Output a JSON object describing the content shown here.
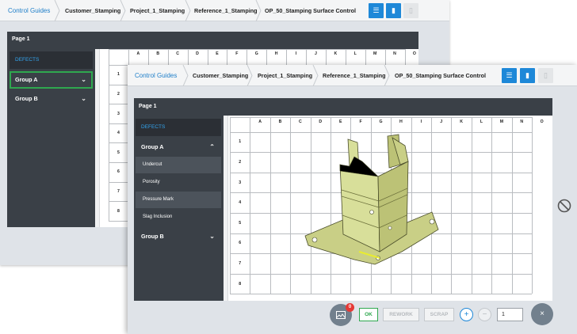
{
  "back_window": {
    "breadcrumbs": [
      "Control Guides",
      "Customer_Stamping",
      "Project_1_Stamping",
      "Reference_1_Stamping",
      "OP_50_Stamping Surface Control"
    ],
    "page_title": "Page 1",
    "sidebar": {
      "defects_label": "DEFECTS",
      "groups": [
        {
          "label": "Group A",
          "expanded": false
        },
        {
          "label": "Group B",
          "expanded": false
        }
      ]
    },
    "grid": {
      "columns": [
        "A",
        "B",
        "C",
        "D",
        "E",
        "F",
        "G",
        "H",
        "I",
        "J",
        "K",
        "L",
        "M",
        "N",
        "O"
      ],
      "rows": [
        "1",
        "2",
        "3",
        "4",
        "5",
        "6",
        "7",
        "8"
      ]
    }
  },
  "front_window": {
    "breadcrumbs": [
      "Control Guides",
      "Customer_Stamping",
      "Project_1_Stamping",
      "Reference_1_Stamping",
      "OP_50_Stamping Surface Control"
    ],
    "page_title": "Page 1",
    "sidebar": {
      "defects_label": "DEFECTS",
      "group_a": {
        "label": "Group A",
        "expanded": true,
        "items": [
          "Undercut",
          "Porosity",
          "Pressure Mark",
          "Slag Inclusion"
        ]
      },
      "group_b": {
        "label": "Group B",
        "expanded": false
      }
    },
    "grid": {
      "columns": [
        "A",
        "B",
        "C",
        "D",
        "E",
        "F",
        "G",
        "H",
        "I",
        "J",
        "K",
        "L",
        "M",
        "N",
        "O"
      ],
      "rows": [
        "1",
        "2",
        "3",
        "4",
        "5",
        "6",
        "7",
        "8"
      ]
    },
    "actions": {
      "photo_badge_count": "0",
      "ok_label": "OK",
      "rework_label": "REWORK",
      "scrap_label": "SCRAP",
      "plus_label": "+",
      "minus_label": "−",
      "quantity": "1",
      "close_label": "×"
    }
  },
  "icons": {
    "toolbar": [
      "filter-list-icon",
      "bookmark-icon",
      "document-icon"
    ],
    "photo": "photo-icon",
    "blocked": "blocked-icon",
    "chevron_down": "chevron-down-icon",
    "chevron_up": "chevron-up-icon"
  },
  "colors": {
    "accent_blue": "#1e88d8",
    "link_blue": "#1e7ec8",
    "defects_blue": "#33a6f0",
    "ok_green": "#2fa84f",
    "badge_red": "#e53935",
    "panel_dark": "#3a4047",
    "part_yellow": "#d8df9a"
  }
}
